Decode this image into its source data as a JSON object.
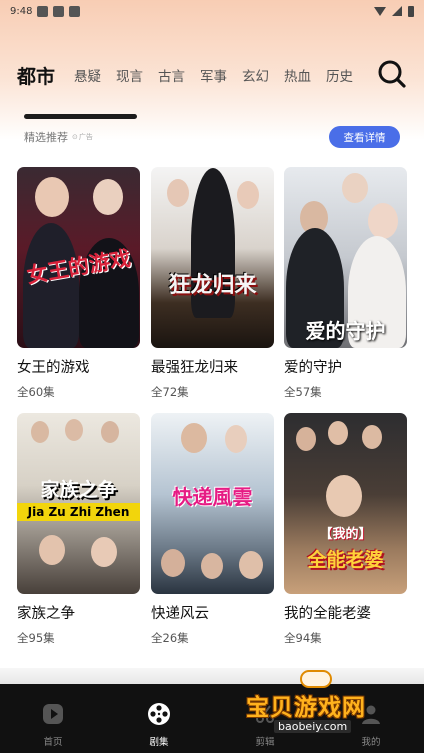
{
  "status_bar": {
    "time": "9:48"
  },
  "category_tabs": [
    "都市",
    "悬疑",
    "现言",
    "古言",
    "军事",
    "玄幻",
    "热血",
    "历史"
  ],
  "recommend": {
    "label": "精选推荐",
    "ad_icon": "ad-tag-icon",
    "ad_label": "广告",
    "detail_button": "查看详情"
  },
  "posters": [
    {
      "title": "女王的游戏",
      "episodes": "全60集",
      "overlay": "女王的游戏",
      "colors": [
        "#2a1a22",
        "#6b2030",
        "#b6243a"
      ]
    },
    {
      "title": "最强狂龙归来",
      "episodes": "全72集",
      "overlay": "狂龙归来",
      "colors": [
        "#f0f0f0",
        "#5a4a3a",
        "#1a1a1a"
      ]
    },
    {
      "title": "爱的守护",
      "episodes": "全57集",
      "overlay": "爱的守护",
      "colors": [
        "#d8dde2",
        "#8b8f96",
        "#3a3c40"
      ]
    },
    {
      "title": "家族之争",
      "episodes": "全95集",
      "overlay": "家族之争",
      "overlay2": "Jia Zu Zhi Zhen",
      "colors": [
        "#e5e2db",
        "#7d6e55",
        "#202020"
      ]
    },
    {
      "title": "快递风云",
      "episodes": "全26集",
      "overlay": "快递風雲",
      "colors": [
        "#e8eef3",
        "#9fb2c4",
        "#3d4a5a"
      ]
    },
    {
      "title": "我的全能老婆",
      "episodes": "全94集",
      "overlay": "全能老婆",
      "overlay_tag": "【我的】",
      "colors": [
        "#2a2a2a",
        "#8a6a50",
        "#c79a6a"
      ]
    }
  ],
  "bottom_nav": [
    {
      "label": "首页",
      "icon": "play-circle-icon"
    },
    {
      "label": "剧集",
      "icon": "film-reel-icon"
    },
    {
      "label": "剪辑",
      "icon": "scissors-icon"
    },
    {
      "label": "我的",
      "icon": "user-icon"
    }
  ],
  "watermark": {
    "main": "宝贝游戏网",
    "sub": "baobeiy.com"
  },
  "accent": "#4a6ee8",
  "nav_bg": "#111111"
}
